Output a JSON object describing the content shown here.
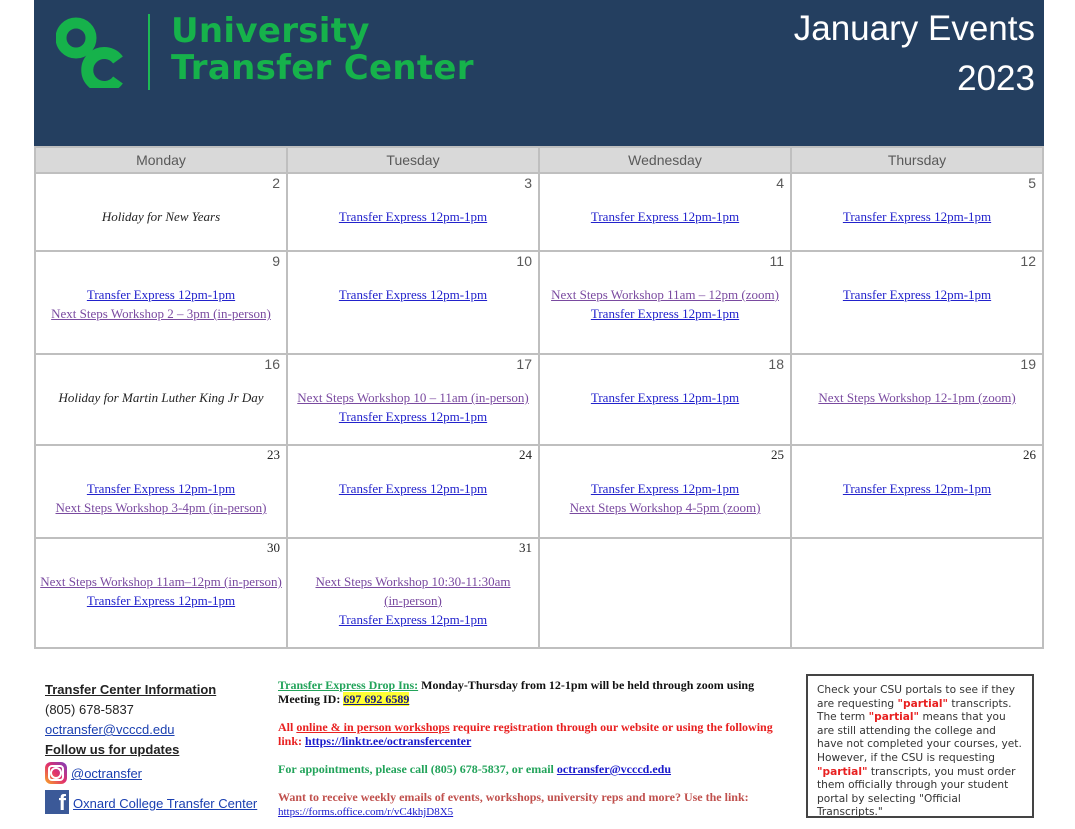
{
  "header": {
    "logo_text": "OC",
    "brand_line1": "University",
    "brand_line2": "Transfer Center",
    "title_line1": "January Events",
    "title_line2": "2023",
    "colors": {
      "background": "#243f60",
      "brand_green": "#16b24b"
    }
  },
  "calendar": {
    "columns": [
      "Monday",
      "Tuesday",
      "Wednesday",
      "Thursday"
    ],
    "weeks": [
      [
        {
          "day": "2",
          "events": [
            {
              "type": "holiday",
              "text": "Holiday for New Years"
            }
          ]
        },
        {
          "day": "3",
          "events": [
            {
              "type": "te",
              "text": "Transfer Express 12pm-1pm"
            }
          ]
        },
        {
          "day": "4",
          "events": [
            {
              "type": "te",
              "text": "Transfer Express 12pm-1pm"
            }
          ]
        },
        {
          "day": "5",
          "events": [
            {
              "type": "te",
              "text": "Transfer Express 12pm-1pm"
            }
          ]
        }
      ],
      [
        {
          "day": "9",
          "events": [
            {
              "type": "te",
              "text": "Transfer Express 12pm-1pm"
            },
            {
              "type": "ns",
              "text": "Next Steps Workshop 2 – 3pm (in-person)"
            }
          ]
        },
        {
          "day": "10",
          "events": [
            {
              "type": "te",
              "text": "Transfer Express 12pm-1pm"
            }
          ]
        },
        {
          "day": "11",
          "events": [
            {
              "type": "ns",
              "text": "Next Steps Workshop 11am – 12pm (zoom)"
            },
            {
              "type": "te",
              "text": "Transfer Express 12pm-1pm"
            }
          ]
        },
        {
          "day": "12",
          "events": [
            {
              "type": "te",
              "text": "Transfer Express 12pm-1pm"
            }
          ]
        }
      ],
      [
        {
          "day": "16",
          "events": [
            {
              "type": "holiday",
              "text": "Holiday for Martin Luther King Jr Day"
            }
          ]
        },
        {
          "day": "17",
          "events": [
            {
              "type": "ns",
              "text": "Next Steps Workshop 10 – 11am (in-person)"
            },
            {
              "type": "te",
              "text": "Transfer Express 12pm-1pm"
            }
          ]
        },
        {
          "day": "18",
          "events": [
            {
              "type": "te",
              "text": "Transfer Express 12pm-1pm"
            }
          ]
        },
        {
          "day": "19",
          "events": [
            {
              "type": "ns",
              "text": "Next Steps Workshop 12-1pm (zoom)"
            }
          ]
        }
      ],
      [
        {
          "day": "23",
          "events": [
            {
              "type": "te",
              "text": "Transfer Express 12pm-1pm"
            },
            {
              "type": "ns",
              "text": "Next Steps Workshop 3-4pm (in-person)"
            }
          ]
        },
        {
          "day": "24",
          "events": [
            {
              "type": "te",
              "text": "Transfer Express 12pm-1pm"
            }
          ]
        },
        {
          "day": "25",
          "events": [
            {
              "type": "te",
              "text": "Transfer Express 12pm-1pm"
            },
            {
              "type": "ns",
              "text": "Next Steps Workshop 4-5pm (zoom)"
            }
          ]
        },
        {
          "day": "26",
          "events": [
            {
              "type": "te",
              "text": "Transfer Express 12pm-1pm"
            }
          ]
        }
      ],
      [
        {
          "day": "30",
          "events": [
            {
              "type": "ns",
              "text": "Next Steps Workshop 11am–12pm (in-person)"
            },
            {
              "type": "te",
              "text": "Transfer Express 12pm-1pm"
            }
          ]
        },
        {
          "day": "31",
          "events": [
            {
              "type": "ns",
              "text": "Next Steps Workshop 10:30-11:30am (in-person)"
            },
            {
              "type": "te",
              "text": "Transfer Express 12pm-1pm"
            }
          ]
        },
        {
          "day": "",
          "events": []
        },
        {
          "day": "",
          "events": []
        }
      ]
    ]
  },
  "info": {
    "heading": "Transfer Center Information",
    "phone": "(805) 678-5837",
    "email": "octransfer@vcccd.edu",
    "follow_heading": "Follow us for updates",
    "instagram": "@octransfer",
    "facebook": "Oxnard College Transfer Center"
  },
  "notices": {
    "drop_in_label": "Transfer Express Drop Ins:",
    "drop_in_text": " Monday-Thursday from 12-1pm will be held through zoom using Meeting ID: ",
    "meeting_id": "697 692 6589",
    "reg_prefix": "All ",
    "reg_link_text": "online & in person workshops",
    "reg_text": " require registration through our website or using the following link: ",
    "reg_url": "https://linktr.ee/octransfercenter",
    "appt_text": "For appointments, please call (805) 678-5837, or email ",
    "appt_email": "octransfer@vcccd.edu",
    "weekly_text": "Want to receive weekly emails of events, workshops, university reps and more? Use the link: ",
    "weekly_url": "https://forms.office.com/r/vC4khjD8X5"
  },
  "csu_box": {
    "t1": "Check your CSU portals to see if they are requesting ",
    "partial": "\"partial\"",
    "t2": " transcripts. The term ",
    "t3": " means that you are still attending the college and have not completed your courses, yet. However, if the CSU is requesting ",
    "t4": " transcripts, you must order them officially through your student portal by selecting \"Official Transcripts.\""
  }
}
